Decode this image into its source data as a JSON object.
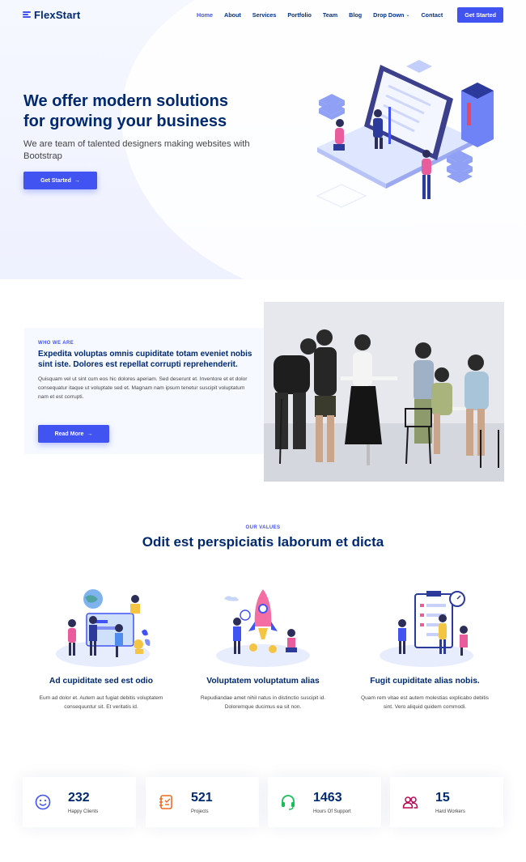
{
  "brand": {
    "name": "FlexStart"
  },
  "nav": {
    "items": [
      {
        "label": "Home",
        "active": true
      },
      {
        "label": "About"
      },
      {
        "label": "Services"
      },
      {
        "label": "Portfolio"
      },
      {
        "label": "Team"
      },
      {
        "label": "Blog"
      },
      {
        "label": "Drop Down"
      },
      {
        "label": "Contact"
      }
    ],
    "cta": "Get Started"
  },
  "hero": {
    "title_line1": "We offer modern solutions",
    "title_line2": "for growing your business",
    "subtitle": "We are team of talented designers making websites with Bootstrap",
    "button": "Get Started",
    "button_icon": "arrow-right-icon"
  },
  "about": {
    "eyebrow": "WHO WE ARE",
    "title": "Expedita voluptas omnis cupiditate totam eveniet nobis sint iste. Dolores est repellat corrupti reprehenderit.",
    "text": "Quisquam vel ut sint cum eos hic dolores aperiam. Sed deserunt et. Inventore et et dolor consequatur itaque ut voluptate sed et. Magnam nam ipsum tenetur suscipit voluptatum nam et est corrupti.",
    "button": "Read More"
  },
  "values": {
    "eyebrow": "OUR VALUES",
    "title": "Odit est perspiciatis laborum et dicta",
    "cards": [
      {
        "title": "Ad cupiditate sed est odio",
        "text": "Eum ad dolor et. Autem aut fugiat debitis voluptatem consequuntur sit. Et veritatis id."
      },
      {
        "title": "Voluptatem voluptatum alias",
        "text": "Repudiandae amet nihil natus in distinctio suscipit id. Doloremque ducimus ea sit non."
      },
      {
        "title": "Fugit cupiditate alias nobis.",
        "text": "Quam rem vitae est autem molestias explicabo debitis sint. Vero aliquid quidem commodi."
      }
    ]
  },
  "counts": [
    {
      "number": "232",
      "label": "Happy Clients",
      "icon": "emoji-smile-icon",
      "color": "#4154f1"
    },
    {
      "number": "521",
      "label": "Projects",
      "icon": "journal-icon",
      "color": "#ee6c20"
    },
    {
      "number": "1463",
      "label": "Hours Of Support",
      "icon": "headset-icon",
      "color": "#15be56"
    },
    {
      "number": "15",
      "label": "Hard Workers",
      "icon": "people-icon",
      "color": "#bb0852"
    }
  ],
  "colors": {
    "accent": "#4154f1",
    "heading": "#012970",
    "body_text": "#444444"
  }
}
